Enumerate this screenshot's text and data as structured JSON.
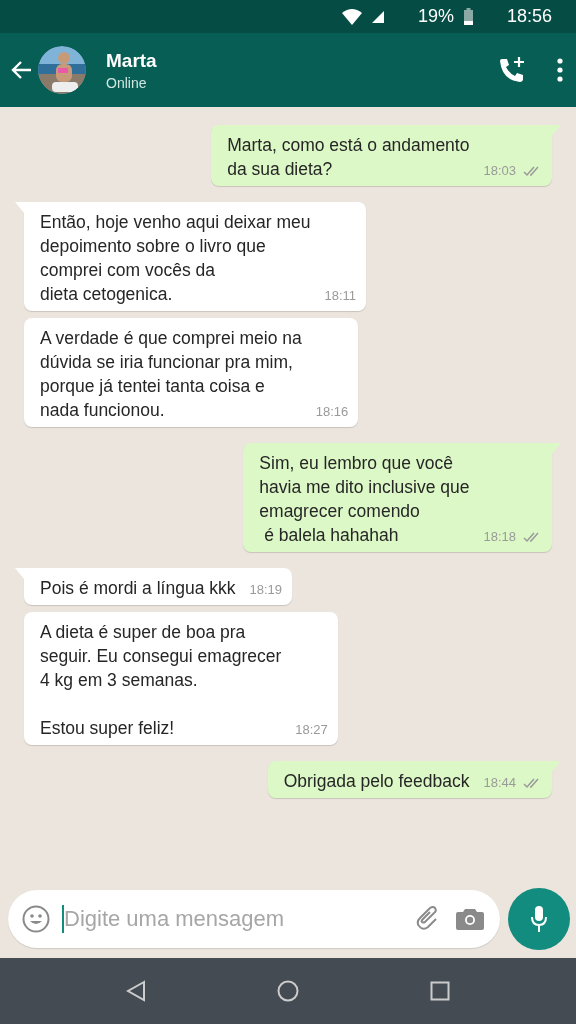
{
  "status_bar": {
    "battery": "19%",
    "time": "18:56"
  },
  "header": {
    "name": "Marta",
    "status": "Online"
  },
  "messages": [
    {
      "kind": "outgoing",
      "tail": true,
      "text": "Marta, como está o andamento\nda sua dieta?",
      "time": "18:03"
    },
    {
      "kind": "incoming",
      "tail": true,
      "text": "Então, hoje venho aqui deixar meu\ndepoimento sobre o livro que\ncomprei com vocês da\ndieta cetogenica.",
      "time": "18:11"
    },
    {
      "kind": "incoming",
      "tail": false,
      "text": "A verdade é que comprei meio na\ndúvida se iria funcionar pra mim,\nporque já tentei tanta coisa e\nnada funcionou.",
      "time": "18:16"
    },
    {
      "kind": "outgoing",
      "tail": true,
      "text": "Sim, eu lembro que você\nhavia me dito inclusive que\nemagrecer comendo\n é balela hahahah",
      "time": "18:18"
    },
    {
      "kind": "incoming",
      "tail": true,
      "text": "Pois é mordi a língua kkk",
      "time": "18:19"
    },
    {
      "kind": "incoming",
      "tail": false,
      "text": "A dieta é super de boa pra\nseguir. Eu consegui emagrecer\n4 kg em 3 semanas.\n\nEstou super feliz!",
      "time": "18:27"
    },
    {
      "kind": "outgoing",
      "tail": true,
      "text": "Obrigada pelo feedback",
      "time": "18:44"
    }
  ],
  "composer": {
    "placeholder": "Digite uma mensagem"
  }
}
